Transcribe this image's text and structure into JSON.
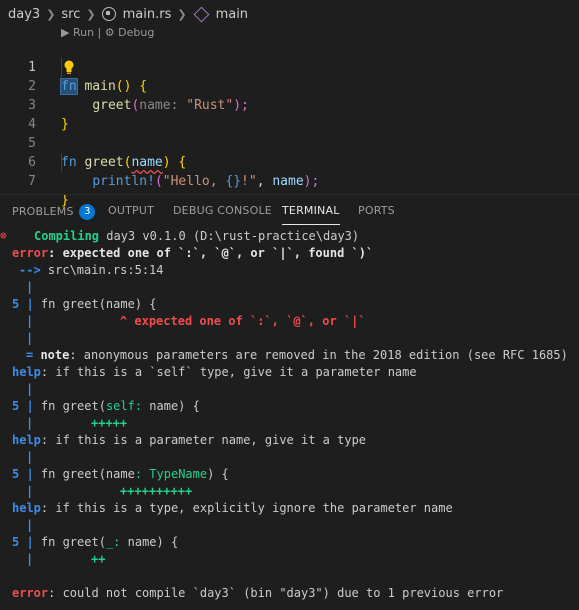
{
  "breadcrumb": {
    "folder": "day3",
    "subfolder": "src",
    "file": "main.rs",
    "symbol": "main"
  },
  "editor": {
    "codelens_run": "Run",
    "codelens_separator": " | ",
    "codelens_debug": "Debug",
    "line_numbers": [
      "1",
      "2",
      "3",
      "4",
      "5",
      "6",
      "7"
    ],
    "l1": {
      "kw": "fn",
      "name": "main",
      "sig": "()",
      "brace": "{"
    },
    "l2": {
      "call": "greet",
      "open": "(",
      "hint": "name:",
      "arg": "\"Rust\"",
      "close": ");"
    },
    "l3": {
      "brace": "}"
    },
    "l5": {
      "kw": "fn",
      "name": "greet",
      "open": "(",
      "param": "name",
      "close": ")",
      "brace": "{"
    },
    "l6": {
      "macro": "println!",
      "open": "(",
      "str_a": "\"Hello, ",
      "placeholder": "{}",
      "str_b": "!\"",
      "comma": ", ",
      "arg": "name",
      "close": ");"
    },
    "l7": {
      "brace": "}"
    }
  },
  "panel": {
    "tabs": {
      "problems": "PROBLEMS",
      "problems_count": "3",
      "output": "OUTPUT",
      "debug_console": "DEBUG CONSOLE",
      "terminal": "TERMINAL",
      "ports": "PORTS"
    }
  },
  "terminal": {
    "compiling_word": "Compiling",
    "compiling_rest": " day3 v0.1.0 (D:\\rust-practice\\day3)",
    "error1_tag": "error",
    "error1_msg": ": expected one of `:`, `@`, or `|`, found `)`",
    "arrow": "-->",
    "location": " src\\main.rs:5:14",
    "bar": "|",
    "gutter5": "5 |",
    "src_line": " fn greet(name) {",
    "caret_line": "            ^ expected one of `:`, `@`, or `|`",
    "note_eq": "= ",
    "note_tag": "note",
    "note_msg": ": anonymous parameters are removed in the 2018 edition (see RFC 1685)",
    "help_tag": "help",
    "help1_msg": ": if this is a `self` type, give it a parameter name",
    "sugg1_pre": " fn greet(",
    "sugg1_add": "self:",
    "sugg1_post": " name) {",
    "sugg1_marks": "        +++++",
    "help2_msg": ": if this is a parameter name, give it a type",
    "sugg2_pre": " fn greet(name",
    "sugg2_add": ": TypeName",
    "sugg2_post": ") {",
    "sugg2_marks": "            ++++++++++",
    "help3_msg": ": if this is a type, explicitly ignore the parameter name",
    "sugg3_pre": " fn greet(",
    "sugg3_add": "_:",
    "sugg3_post": " name) {",
    "sugg3_marks": "        ++",
    "error2_tag": "error",
    "error2_msg": ": could not compile `day3` (bin \"day3\") due to 1 previous error"
  },
  "colors": {
    "background": "#1e1e1e",
    "error": "#f14c4c",
    "success": "#23d18b",
    "info": "#3b8eea",
    "badge": "#0078d4"
  }
}
